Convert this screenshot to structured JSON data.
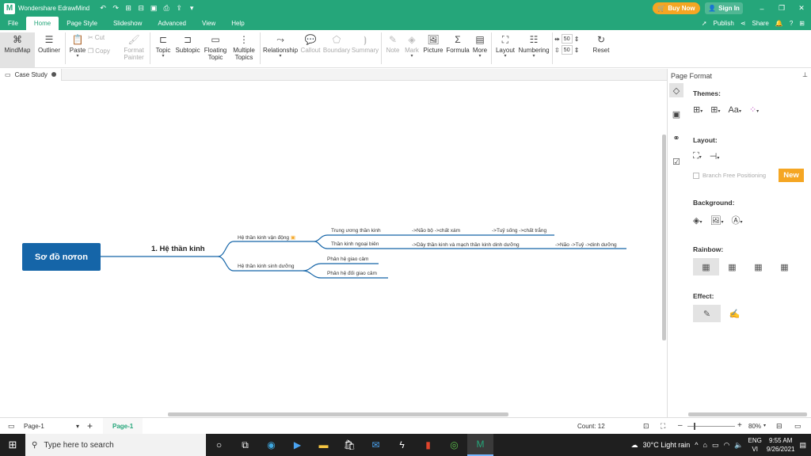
{
  "app": {
    "title": "Wondershare EdrawMind",
    "buy_label": "Buy Now",
    "signin_label": "Sign In"
  },
  "menubar": {
    "items": [
      "File",
      "Home",
      "Page Style",
      "Slideshow",
      "Advanced",
      "View",
      "Help"
    ],
    "active": "Home",
    "publish_label": "Publish",
    "share_label": "Share"
  },
  "ribbon": {
    "mindmap": "MindMap",
    "outliner": "Outliner",
    "paste": "Paste",
    "cut": "Cut",
    "copy": "Copy",
    "format_painter": "Format Painter",
    "topic": "Topic",
    "subtopic": "Subtopic",
    "floating_topic": "Floating Topic",
    "multiple_topics": "Multiple Topics",
    "relationship": "Relationship",
    "callout": "Callout",
    "boundary": "Boundary",
    "summary": "Summary",
    "note": "Note",
    "mark": "Mark",
    "picture": "Picture",
    "formula": "Formula",
    "more": "More",
    "layout": "Layout",
    "numbering": "Numbering",
    "spacing_h": "50",
    "spacing_v": "50",
    "reset": "Reset"
  },
  "document_tab": "Case Study",
  "mindmap": {
    "central": "Sơ đồ nơron",
    "main_topic": "1. Hệ thần kinh",
    "branch_1": "Hệ thần kinh vận động",
    "branch_1_sub_1": "Trung ương thần kinh",
    "branch_1_sub_1_a": "->Não bộ ->chất xám",
    "branch_1_sub_1_b": "->Tuỷ sống ->chất trắng",
    "branch_1_sub_2": "Thần kinh ngoại biên",
    "branch_1_sub_2_a": "->Dây thần kinh và mạch thần kinh dinh dưỡng",
    "branch_1_sub_2_b": "->Não ->Tuỷ ->dinh dưỡng",
    "branch_2": "Hệ thần kinh sinh dưỡng",
    "branch_2_sub_1": "Phân hệ giao cảm",
    "branch_2_sub_2": "Phân hệ đối giao cảm"
  },
  "panel": {
    "title": "Page Format",
    "themes": "Themes:",
    "layout": "Layout:",
    "branch_free": "Branch Free Positioning",
    "new_badge": "New",
    "background": "Background:",
    "rainbow": "Rainbow:",
    "effect": "Effect:"
  },
  "status": {
    "page_select": "Page-1",
    "page_tab": "Page-1",
    "count": "Count: 12",
    "zoom": "80%"
  },
  "taskbar": {
    "search_placeholder": "Type here to search",
    "weather": "30°C  Light rain",
    "lang_top": "ENG",
    "lang_bottom": "VI",
    "time": "9:55 AM",
    "date": "9/26/2021"
  },
  "colors": {
    "brand_green": "#25a67a",
    "central_blue": "#1565a8",
    "connector_blue": "#1565a8",
    "accent_orange": "#f5a623"
  }
}
